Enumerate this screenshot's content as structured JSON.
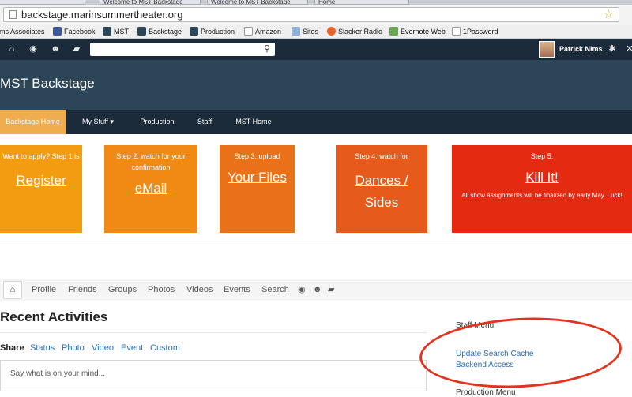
{
  "browser": {
    "tabs": [
      "Welcome to MST Backstage",
      "Welcome to MST Backstage",
      "Home"
    ],
    "url": "backstage.marinsummertheater.org",
    "bookmarks": [
      "ms Associates",
      "Facebook",
      "MST",
      "Backstage",
      "Production",
      "Amazon",
      "Sites",
      "Slacker Radio",
      "Evernote Web",
      "1Password"
    ]
  },
  "toolbar": {
    "user_name": "Patrick Nims",
    "icons": [
      "home-icon",
      "globe-icon",
      "users-icon",
      "chat-icon",
      "gear-icon",
      "close-icon"
    ]
  },
  "site": {
    "title": "MST Backstage",
    "nav": [
      "Backstage Home",
      "My Stuff",
      "Production",
      "Staff",
      "MST Home"
    ],
    "nav_dropdown_caret": "▾"
  },
  "tiles": [
    {
      "step": "Want to apply?  Step 1 is",
      "link": "Register",
      "color": "#f39c12"
    },
    {
      "step": "Step 2: watch for your confirmation",
      "link": "eMail",
      "color": "#f08a12"
    },
    {
      "step": "Step 3: upload",
      "link": "Your Files",
      "color": "#e9711a"
    },
    {
      "step": "Step 4: watch for",
      "link": "Dances / Sides",
      "color": "#e65a1c"
    },
    {
      "step": "Step 5:",
      "link": "Kill It!",
      "note": "All show assignments will be finalized by early May. Luck!",
      "color": "#e52a12"
    }
  ],
  "profile_tabs": [
    "Profile",
    "Friends",
    "Groups",
    "Photos",
    "Videos",
    "Events",
    "Search"
  ],
  "activities": {
    "heading": "Recent Activities",
    "share_label": "Share",
    "share_options": [
      "Status",
      "Photo",
      "Video",
      "Event",
      "Custom"
    ],
    "placeholder": "Say what is on your mind..."
  },
  "sidebar": {
    "staff_menu": "Staff Menu",
    "links": [
      "Update Search Cache",
      "Backend Access"
    ],
    "production_menu": "Production Menu"
  },
  "annotation_color": "#e3331f"
}
